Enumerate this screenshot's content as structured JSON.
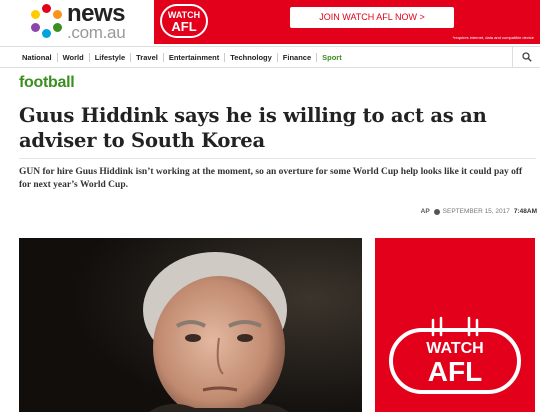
{
  "site": {
    "logo_news": "news",
    "logo_domain": ".com.au",
    "dot_colors": [
      "#e2001a",
      "#f7941d",
      "#3a8f1f",
      "#00a3e0",
      "#8e44ad",
      "#ffcc00"
    ]
  },
  "top_banner": {
    "logo_line1": "WATCH",
    "logo_line2": "AFL",
    "cta": "JOIN WATCH AFL NOW >",
    "fine_print": "*requires internet, data and compatible device",
    "color": "#e2001a"
  },
  "nav": {
    "items": [
      "National",
      "World",
      "Lifestyle",
      "Travel",
      "Entertainment",
      "Technology",
      "Finance",
      "Sport"
    ],
    "active": "Sport",
    "search_icon": "search-icon"
  },
  "article": {
    "section": "football",
    "headline": "Guus Hiddink says he is willing to act as an adviser to South Korea",
    "standfirst": "GUN for hire Guus Hiddink isn’t working at the moment, so an overture for some World Cup help looks like it could pay off for next year’s World Cup.",
    "author": "AP",
    "date": "SEPTEMBER 15, 2017",
    "time": "7:48AM"
  },
  "side_ad": {
    "line1": "WATCH",
    "line2": "AFL"
  },
  "colors": {
    "accent_green": "#3a8f1f",
    "brand_red": "#e2001a"
  }
}
